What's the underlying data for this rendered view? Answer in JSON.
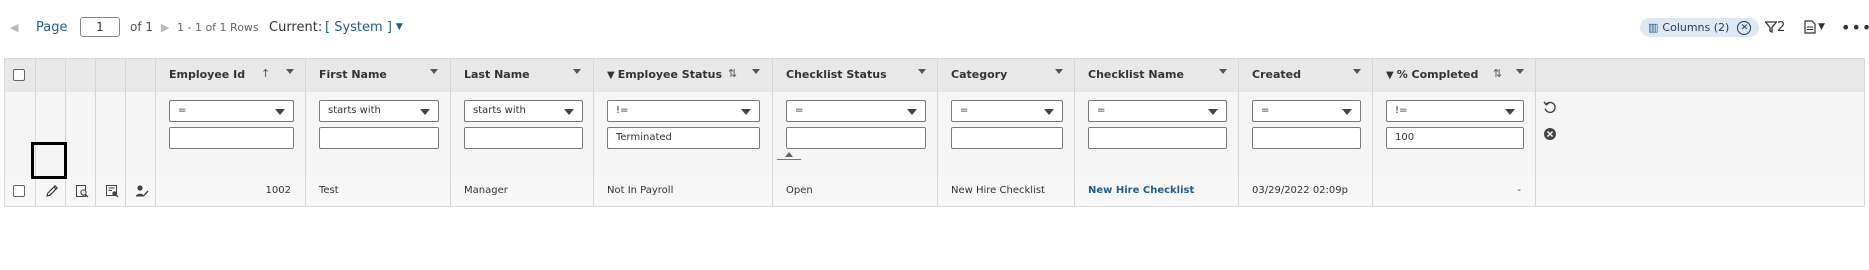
{
  "toolbar": {
    "page_label": "Page",
    "page_value": "1",
    "of_label": "of 1",
    "rows_label": "1 - 1 of 1 Rows",
    "current_label": "Current:",
    "current_value": "[ System ]",
    "columns_label": "Columns (2)",
    "filter_count": "2"
  },
  "columns": [
    {
      "label": "Employee Id",
      "filtered": false,
      "sort": "asc",
      "operator": "=",
      "filter_value": ""
    },
    {
      "label": "First Name",
      "filtered": false,
      "sort": "",
      "operator": "starts with",
      "filter_value": ""
    },
    {
      "label": "Last Name",
      "filtered": false,
      "sort": "",
      "operator": "starts with",
      "filter_value": ""
    },
    {
      "label": "Employee Status",
      "filtered": true,
      "sort": "both",
      "operator": "!=",
      "filter_value": "Terminated"
    },
    {
      "label": "Checklist Status",
      "filtered": false,
      "sort": "",
      "operator": "=",
      "filter_value": ""
    },
    {
      "label": "Category",
      "filtered": false,
      "sort": "",
      "operator": "=",
      "filter_value": ""
    },
    {
      "label": "Checklist Name",
      "filtered": false,
      "sort": "",
      "operator": "=",
      "filter_value": ""
    },
    {
      "label": "Created",
      "filtered": false,
      "sort": "",
      "operator": "=",
      "filter_value": ""
    },
    {
      "label": "% Completed",
      "filtered": true,
      "sort": "both",
      "operator": "!=",
      "filter_value": "100"
    }
  ],
  "rows": [
    {
      "employee_id": "1002",
      "first_name": "Test",
      "last_name": "Manager",
      "employee_status": "Not In Payroll",
      "checklist_status": "Open",
      "category": "New Hire Checklist",
      "checklist_name": "New Hire Checklist",
      "created": "03/29/2022 02:09p",
      "percent_completed": "-"
    }
  ],
  "row_actions": [
    "edit-pencil-icon",
    "view-details-icon",
    "view-record-icon",
    "assign-user-icon"
  ],
  "colors": {
    "link": "#1f5d8f",
    "header_bg": "#e8e8e8",
    "chip_bg": "#dfe8f1"
  }
}
